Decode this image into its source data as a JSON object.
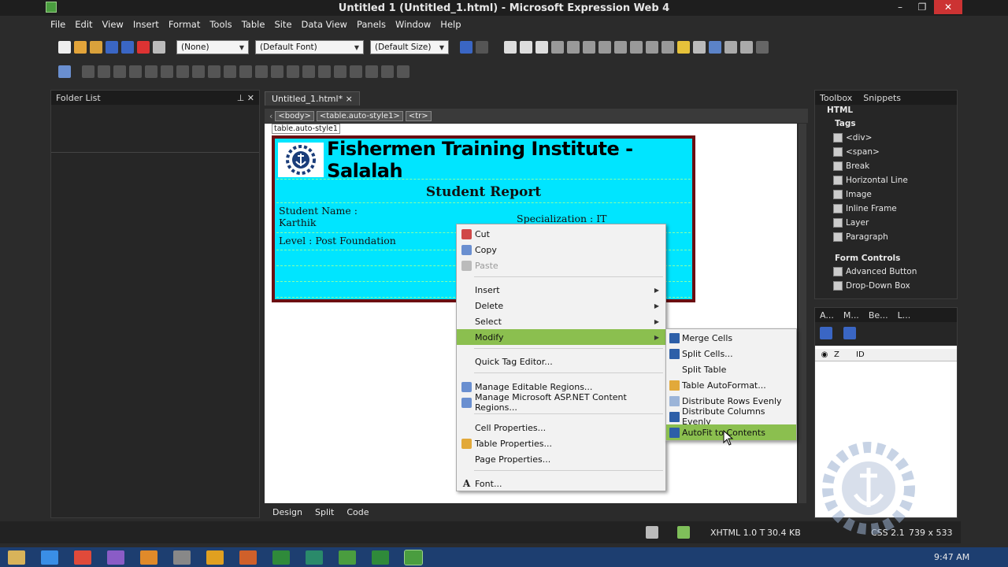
{
  "window": {
    "title": "Untitled 1 (Untitled_1.html) - Microsoft Expression Web 4"
  },
  "menu": [
    "File",
    "Edit",
    "View",
    "Insert",
    "Format",
    "Tools",
    "Table",
    "Site",
    "Data View",
    "Panels",
    "Window",
    "Help"
  ],
  "toolbar": {
    "style_value": "(None)",
    "font_value": "(Default Font)",
    "size_value": "(Default Size)"
  },
  "folder_list": {
    "title": "Folder List"
  },
  "editor": {
    "tab": "Untitled_1.html*",
    "crumbs": [
      "<body>",
      "<table.auto-style1>",
      "<tr>"
    ],
    "selection_label": "table.auto-style1"
  },
  "document": {
    "title": "Fishermen Training Institute - Salalah",
    "subtitle": "Student Report",
    "student_name": "Student Name :",
    "student_value": "Karthik",
    "specialization": "Specialization : IT",
    "level": "Level : Post Foundation"
  },
  "context_menu": {
    "items": [
      "Cut",
      "Copy",
      "Paste",
      "Insert",
      "Delete",
      "Select",
      "Modify",
      "Quick Tag Editor...",
      "Manage Editable Regions...",
      "Manage Microsoft ASP.NET Content Regions...",
      "Cell Properties...",
      "Table Properties...",
      "Page Properties...",
      "Font..."
    ]
  },
  "modify_submenu": {
    "items": [
      "Merge Cells",
      "Split Cells...",
      "Split Table",
      "Table AutoFormat...",
      "Distribute Rows Evenly",
      "Distribute Columns Evenly",
      "AutoFit to Contents"
    ]
  },
  "toolbox": {
    "tabs": [
      "Toolbox",
      "Snippets"
    ],
    "section": "HTML",
    "tags_heading": "Tags",
    "tags": [
      "<div>",
      "<span>",
      "Break",
      "Horizontal Line",
      "Image",
      "Inline Frame",
      "Layer",
      "Paragraph"
    ],
    "form_heading": "Form Controls",
    "form_items": [
      "Advanced Button",
      "Drop-Down Box"
    ]
  },
  "layers_panel": {
    "tabs": [
      "A...",
      "M...",
      "Be...",
      "L..."
    ],
    "columns": [
      "Z",
      "ID"
    ]
  },
  "view_tabs": [
    "Design",
    "Split",
    "Code"
  ],
  "status": {
    "doctype": "XHTML 1.0 T",
    "size": "30.4 KB",
    "css": "CSS 2.1",
    "dimensions": "739 x 533"
  },
  "taskbar": {
    "time": "9:47 AM"
  },
  "colors": {
    "accent": "#8bbf4f",
    "doc_bg": "#00e5ff",
    "doc_border": "#6b0f12"
  }
}
